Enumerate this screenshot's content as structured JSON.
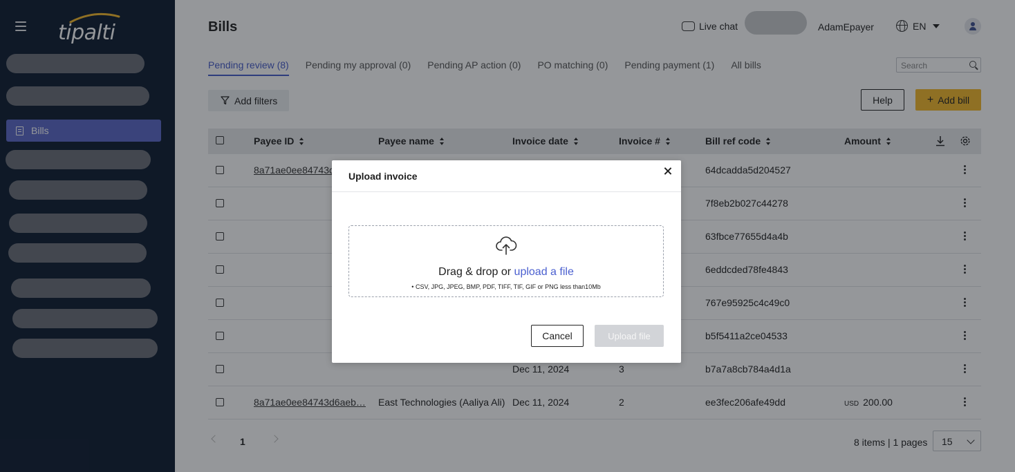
{
  "app": {
    "logo_text": "tipalti"
  },
  "sidebar": {
    "bills_label": "Bills"
  },
  "header": {
    "title": "Bills",
    "live_chat": "Live chat",
    "username": "AdamEpayer",
    "language": "EN"
  },
  "tabs": [
    {
      "label": "Pending review (8)"
    },
    {
      "label": "Pending my approval (0)"
    },
    {
      "label": "Pending AP action (0)"
    },
    {
      "label": "PO matching (0)"
    },
    {
      "label": "Pending payment (1)"
    },
    {
      "label": "All bills"
    }
  ],
  "search": {
    "placeholder": "Search"
  },
  "toolbar": {
    "filters": "Add filters",
    "help": "Help",
    "add_bill": "Add bill"
  },
  "table": {
    "columns": [
      "Payee ID",
      "Payee name",
      "Invoice date",
      "Invoice #",
      "Bill ref code",
      "Amount"
    ],
    "rows": [
      {
        "payee_id": "8a71ae0ee84743d",
        "payee_name": "",
        "date": "",
        "invoice": "",
        "ref": "64dcadda5d204527",
        "currency": "",
        "amount": ""
      },
      {
        "payee_id": "",
        "payee_name": "",
        "date": "",
        "invoice": "",
        "ref": "7f8eb2b027c44278",
        "currency": "",
        "amount": ""
      },
      {
        "payee_id": "",
        "payee_name": "",
        "date": "",
        "invoice": "",
        "ref": "63fbce77655d4a4b",
        "currency": "",
        "amount": ""
      },
      {
        "payee_id": "",
        "payee_name": "",
        "date": "",
        "invoice": "",
        "ref": "6eddcded78fe4843",
        "currency": "",
        "amount": ""
      },
      {
        "payee_id": "",
        "payee_name": "",
        "date": "",
        "invoice": "",
        "ref": "767e95925c4c49c0",
        "currency": "",
        "amount": ""
      },
      {
        "payee_id": "",
        "payee_name": "",
        "date": "",
        "invoice": "",
        "ref": "b5f5411a2ce04533",
        "currency": "",
        "amount": ""
      },
      {
        "payee_id": "",
        "payee_name": "",
        "date": "Dec 11, 2024",
        "invoice": "3",
        "ref": "b7a7a8cb784a4d1a",
        "currency": "",
        "amount": ""
      },
      {
        "payee_id": "8a71ae0ee84743d6aeb…",
        "payee_name": "East Technologies (Aaliya Ali)",
        "date": "Dec 11, 2024",
        "invoice": "2",
        "ref": "ee3fec206afe49dd",
        "currency": "USD",
        "amount": "200.00"
      }
    ]
  },
  "pager": {
    "page": "1",
    "summary": "8 items | 1 pages",
    "page_size": "15"
  },
  "modal": {
    "title": "Upload invoice",
    "drag_text": "Drag & drop or ",
    "upload_link": "upload a file",
    "hint": "•  CSV, JPG, JPEG, BMP, PDF, TIFF, TIF, GIF or PNG less than10Mb",
    "cancel": "Cancel",
    "upload": "Upload file"
  },
  "colors": {
    "sidebar": "#0c1a2e",
    "accent": "#4459c9",
    "add_bill": "#f5b928"
  }
}
